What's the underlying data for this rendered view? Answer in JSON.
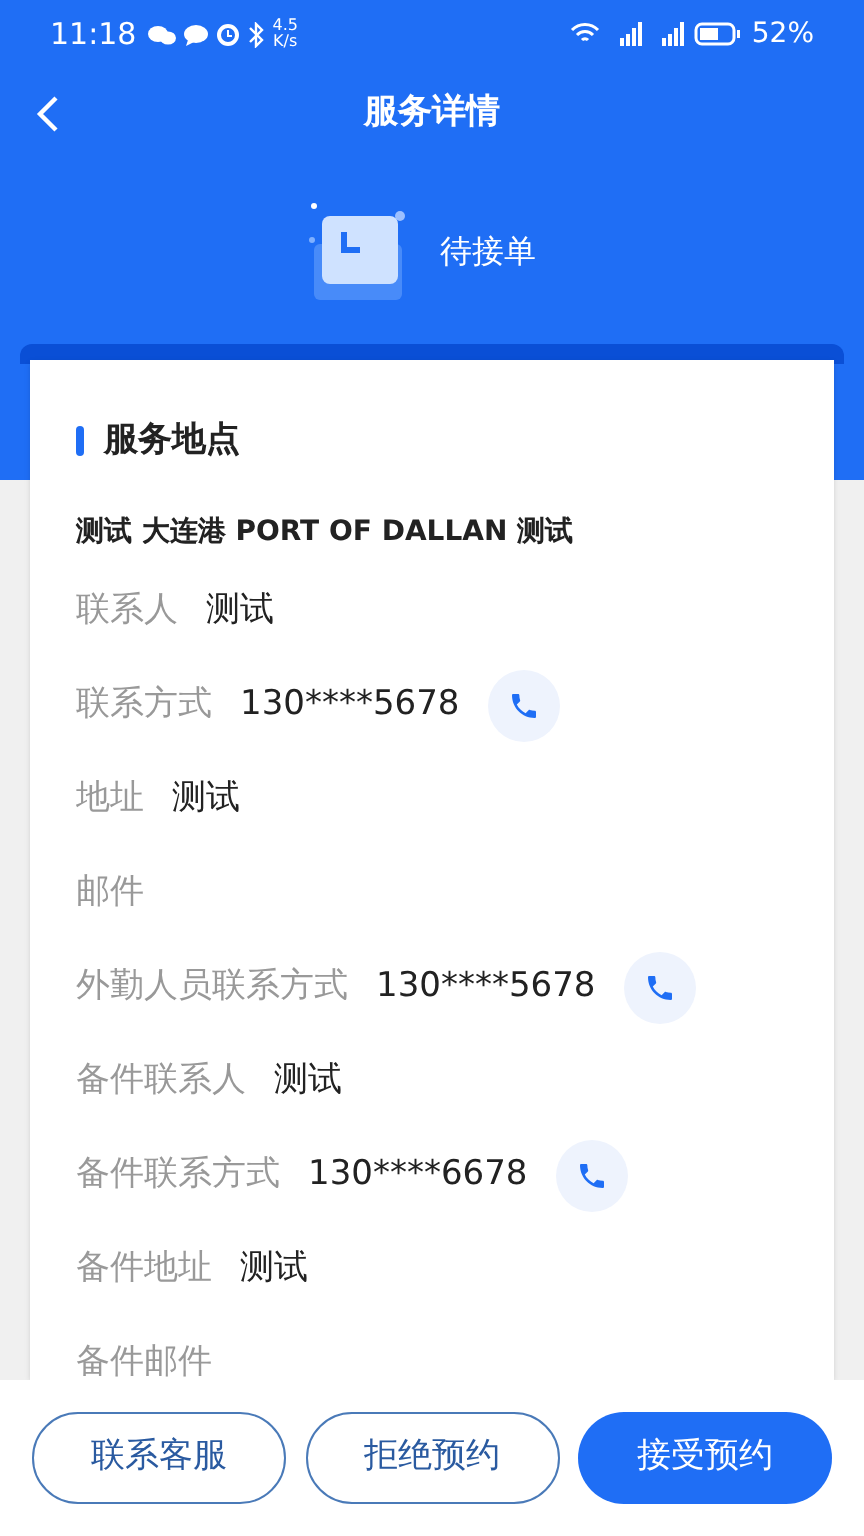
{
  "status_bar": {
    "time": "11:18",
    "net_speed": "4.5\nK/s",
    "battery": "52%"
  },
  "header": {
    "title": "服务详情"
  },
  "order_status": {
    "label": "待接单"
  },
  "section": {
    "title": "服务地点",
    "place": "测试 大连港 PORT OF DALLAN 测试",
    "fields": [
      {
        "kind": "text",
        "label": "联系人",
        "value": "测试"
      },
      {
        "kind": "phone",
        "label": "联系方式",
        "value": "130****5678"
      },
      {
        "kind": "text",
        "label": "地址",
        "value": "测试"
      },
      {
        "kind": "text",
        "label": "邮件"
      },
      {
        "kind": "phone",
        "label": "外勤人员联系方式",
        "value": "130****5678"
      },
      {
        "kind": "text",
        "label": "备件联系人",
        "value": "测试"
      },
      {
        "kind": "phone",
        "label": "备件联系方式",
        "value": "130****6678"
      },
      {
        "kind": "text",
        "label": "备件地址",
        "value": "测试"
      },
      {
        "kind": "text",
        "label": "备件邮件"
      }
    ]
  },
  "buttons": [
    {
      "label": "联系客服",
      "primary": false
    },
    {
      "label": "拒绝预约",
      "primary": false
    },
    {
      "label": "接受预约",
      "primary": true
    }
  ]
}
